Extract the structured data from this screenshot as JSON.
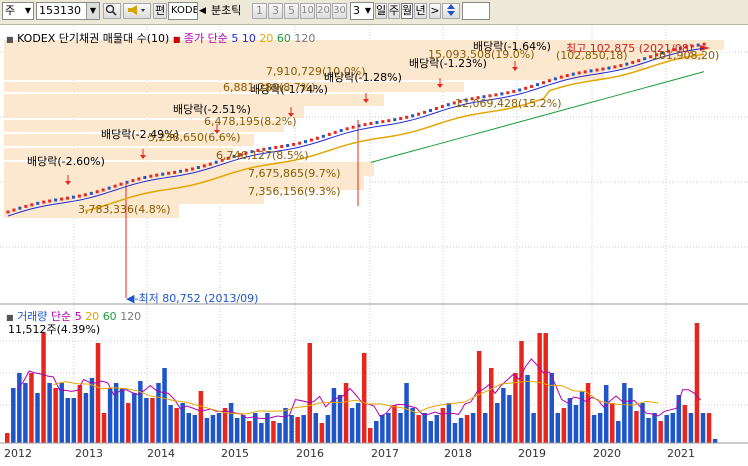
{
  "toolbar": {
    "market": "주",
    "code": "153130",
    "search_icon": "magnifier-icon",
    "sound_icon": "speaker-icon",
    "edit_btn": "편",
    "name_box": "KODEX",
    "prev_arrow": "◀",
    "tick_label": "분초틱",
    "minute_buttons": [
      "1",
      "3",
      "5",
      "10",
      "20",
      "30"
    ],
    "interval_value": "3",
    "period_buttons": [
      "일",
      "주",
      "월",
      "년"
    ],
    "period_selected": "월",
    "more_arrow": ">",
    "updown_icon": "up-down-arrow-icon"
  },
  "price_panel": {
    "title": "KODEX 단기채권 매물대 수(10)",
    "ma_label": "종가 단순",
    "ma_periods": [
      "5",
      "10",
      "20",
      "60",
      "120"
    ],
    "ma_colors": [
      "#1f2bd8",
      "#1f2bd8",
      "#e3a600",
      "#1d9e3c",
      "#7a7a7a"
    ]
  },
  "volume_panel": {
    "title": "거래량",
    "ma_label": "단순",
    "ma_periods": [
      "5",
      "20",
      "60",
      "120"
    ],
    "ma_colors": [
      "#b000b0",
      "#e3a600",
      "#1d9e3c",
      "#7a7a7a"
    ],
    "current_value": "11,512주(4.39%)"
  },
  "annotations": {
    "high_label": "최고 102,875 (2021/08)",
    "low_label": "최저 80,752 (2013/09)",
    "dividends": [
      "배당락(-2.60%)",
      "배당락(-2.49%)",
      "배당락(-2.51%)",
      "배당락(-1.74%)",
      "배당락(-1.28%)",
      "배당락(-1.23%)",
      "배당락(-1.64%)"
    ],
    "volume_profile": [
      "3,783,336(4.8%)",
      "5,238,650(6.6%)",
      "6,478,195(8.2%)",
      "6,881,289(8.7%)",
      "7,910,729(10.0%)",
      "6,746,127(8.5%)",
      "7,675,865(9.7%)",
      "7,356,156(9.3%)",
      "12,069,428(15.2%)",
      "15,093,508(19.0%)",
      "(102,850,18)",
      "101,908,20)"
    ]
  },
  "x_axis": [
    "2012",
    "2013",
    "2014",
    "2015",
    "2016",
    "2017",
    "2018",
    "2019",
    "2020",
    "2021"
  ],
  "colors": {
    "up": "#e8261e",
    "down": "#1e55c8",
    "profile": "#fbe8cf",
    "grid": "#cccccc"
  },
  "chart_data": [
    {
      "type": "candlestick",
      "title": "KODEX 단기채권 매물대 수(10)",
      "period": "monthly",
      "x": [
        "2012-01",
        "2021-12"
      ],
      "ylim": [
        80000,
        104000
      ],
      "high": {
        "value": 102875,
        "date": "2021/08"
      },
      "low": {
        "value": 80752,
        "date": "2013/09"
      },
      "series": [
        {
          "name": "종가 단순 5",
          "color": "#1f2bd8"
        },
        {
          "name": "종가 단순 10",
          "color": "#1f2bd8"
        },
        {
          "name": "종가 단순 20",
          "color": "#e3a600"
        },
        {
          "name": "종가 단순 60",
          "color": "#1d9e3c"
        },
        {
          "name": "종가 단순 120",
          "color": "#7a7a7a"
        }
      ]
    },
    {
      "type": "bar",
      "title": "거래량",
      "categories": [
        "2012",
        "2013",
        "2014",
        "2015",
        "2016",
        "2017",
        "2018",
        "2019",
        "2020",
        "2021"
      ],
      "series": [
        {
          "name": "단순 5",
          "color": "#b000b0"
        },
        {
          "name": "단순 20",
          "color": "#e3a600"
        },
        {
          "name": "단순 60",
          "color": "#1d9e3c"
        },
        {
          "name": "단순 120",
          "color": "#7a7a7a"
        }
      ]
    }
  ]
}
